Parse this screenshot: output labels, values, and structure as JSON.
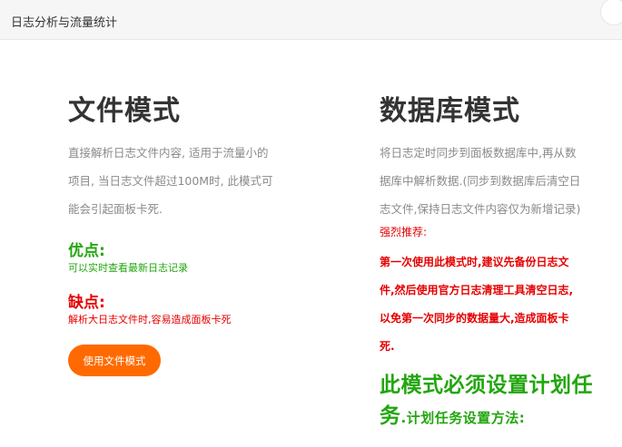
{
  "window": {
    "title": "日志分析与流量统计"
  },
  "file_mode": {
    "heading": "文件模式",
    "desc_lines": [
      "直接解析日志文件内容, 适用于流量小的",
      "项目, 当日志文件超过100M时, 此模式可",
      "能会引起面板卡死."
    ],
    "pros_title": "优点:",
    "pros_text": "可以实时查看最新日志记录",
    "cons_title": "缺点:",
    "cons_text": "解析大日志文件时,容易造成面板卡死",
    "button_label": "使用文件模式"
  },
  "db_mode": {
    "heading": "数据库模式",
    "desc_lines": [
      "将日志定时同步到面板数据库中,再从数",
      "据库中解析数据.(同步到数据库后清空日",
      "志文件,保持日志文件内容仅为新增记录)"
    ],
    "recommend_label": "强烈推荐:",
    "recommend_lines": [
      "第一次使用此模式时,建议先备份日志文",
      "件,然后使用官方日志清理工具清空日志,",
      "以免第一次同步的数据量大,造成面板卡",
      "死."
    ],
    "notice_line1": "此模式必须设置计划任",
    "notice_line2_big": "务",
    "notice_line2_small": ".计划任务设置方法:"
  },
  "colors": {
    "accent_orange": "#ff6a00",
    "green": "#22a60f",
    "red": "#e60000",
    "muted": "#8a8a8a"
  }
}
